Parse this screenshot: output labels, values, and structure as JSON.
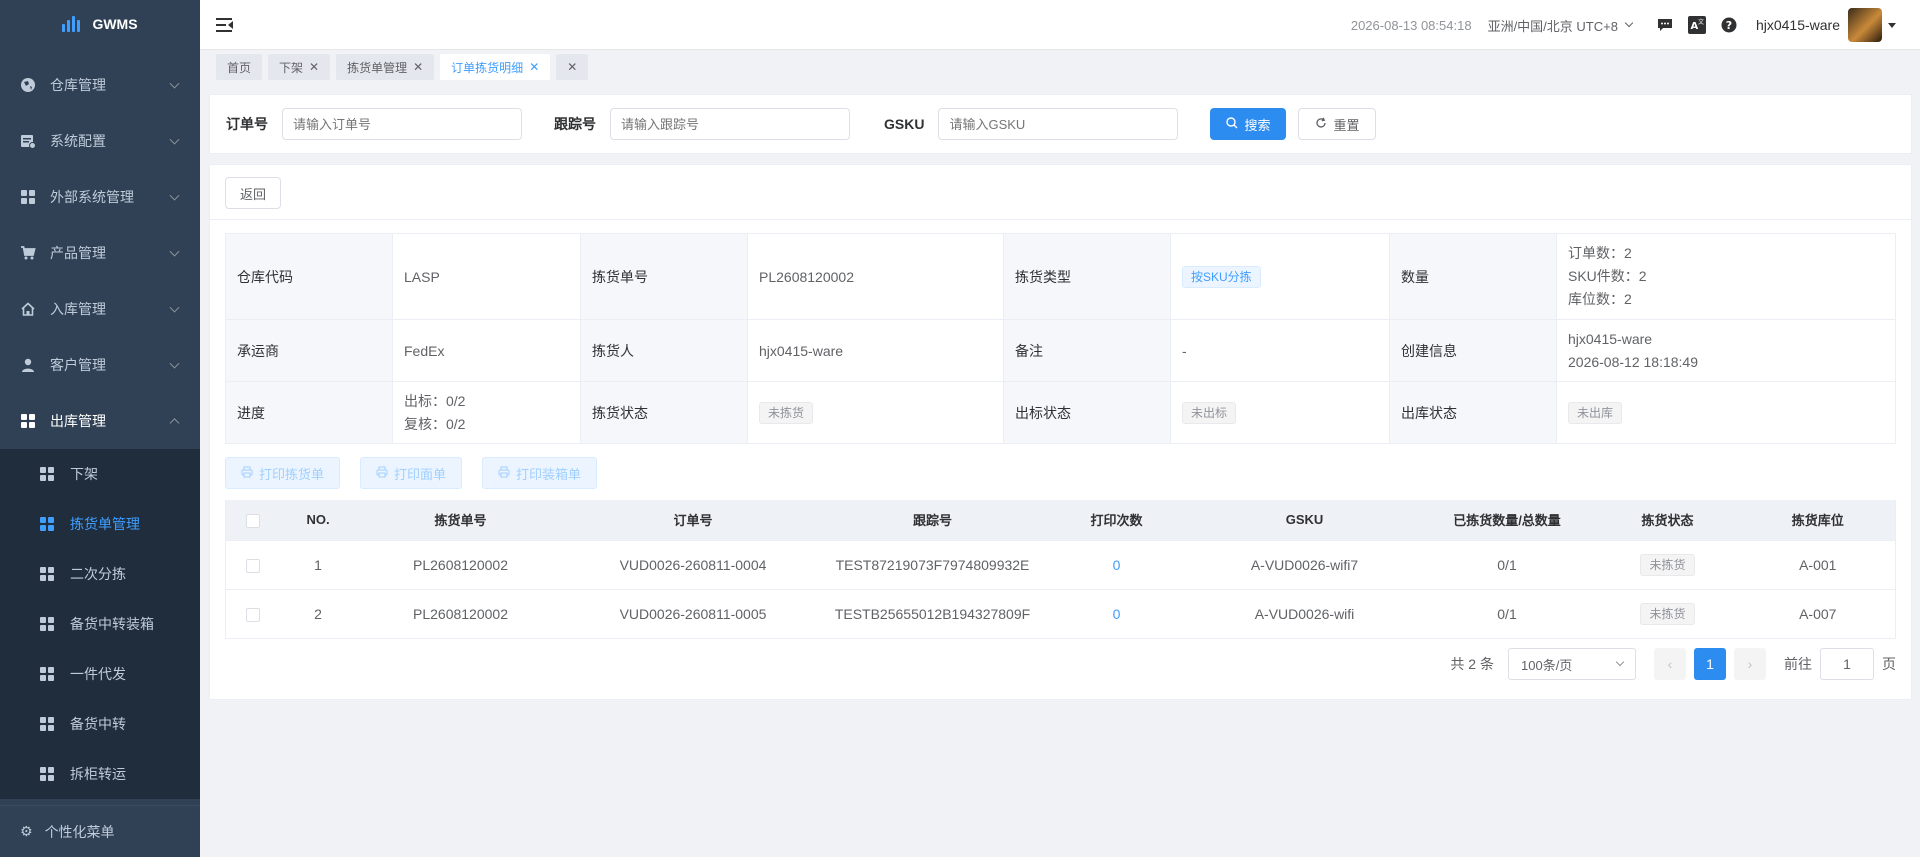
{
  "app": {
    "logo_text": "GWMS"
  },
  "sidebar": {
    "items": [
      {
        "label": "仓库管理",
        "icon": "globe-icon"
      },
      {
        "label": "系统配置",
        "icon": "config-icon"
      },
      {
        "label": "外部系统管理",
        "icon": "grid-icon"
      },
      {
        "label": "产品管理",
        "icon": "cart-icon"
      },
      {
        "label": "入库管理",
        "icon": "home-icon"
      },
      {
        "label": "客户管理",
        "icon": "user-icon"
      },
      {
        "label": "出库管理",
        "icon": "grid-icon"
      }
    ],
    "sub_items": [
      {
        "label": "下架"
      },
      {
        "label": "拣货单管理"
      },
      {
        "label": "二次分拣"
      },
      {
        "label": "备货中转装箱"
      },
      {
        "label": "一件代发"
      },
      {
        "label": "备货中转"
      },
      {
        "label": "拆柜转运"
      }
    ],
    "footer_label": "个性化菜单"
  },
  "header": {
    "datetime": "2026-08-13 08:54:18",
    "timezone": "亚洲/中国/北京 UTC+8",
    "username": "hjx0415-ware"
  },
  "tags": [
    {
      "label": "首页"
    },
    {
      "label": "下架"
    },
    {
      "label": "拣货单管理"
    },
    {
      "label": "订单拣货明细"
    }
  ],
  "search": {
    "order_label": "订单号",
    "order_placeholder": "请输入订单号",
    "tracking_label": "跟踪号",
    "tracking_placeholder": "请输入跟踪号",
    "gsku_label": "GSKU",
    "gsku_placeholder": "请输入GSKU",
    "search_btn": "搜索",
    "reset_btn": "重置"
  },
  "back_btn": "返回",
  "detail": {
    "warehouse_code_label": "仓库代码",
    "warehouse_code": "LASP",
    "pick_no_label": "拣货单号",
    "pick_no": "PL2608120002",
    "pick_type_label": "拣货类型",
    "pick_type": "按SKU分拣",
    "qty_label": "数量",
    "order_count": "订单数：2",
    "sku_count": "SKU件数：2",
    "location_count": "库位数：2",
    "carrier_label": "承运商",
    "carrier": "FedEx",
    "picker_label": "拣货人",
    "picker": "hjx0415-ware",
    "remark_label": "备注",
    "remark": "-",
    "created_label": "创建信息",
    "created_by": "hjx0415-ware",
    "created_at": "2026-08-12 18:18:49",
    "progress_label": "进度",
    "progress_label_out": "出标：0/2",
    "progress_review": "复核：0/2",
    "pick_status_label": "拣货状态",
    "pick_status": "未拣货",
    "label_status_label": "出标状态",
    "label_status": "未出标",
    "outbound_status_label": "出库状态",
    "outbound_status": "未出库"
  },
  "actions": {
    "print_pick": "打印拣货单",
    "print_sheet": "打印面单",
    "print_box": "打印装箱单"
  },
  "table": {
    "columns": [
      "NO.",
      "拣货单号",
      "订单号",
      "跟踪号",
      "打印次数",
      "GSKU",
      "已拣货数量/总数量",
      "拣货状态",
      "拣货库位"
    ],
    "rows": [
      {
        "no": "1",
        "pick_no": "PL2608120002",
        "order_no": "VUD0026-260811-0004",
        "tracking": "TEST87219073F7974809932E",
        "print_count": "0",
        "gsku": "A-VUD0026-wifi7",
        "qty": "0/1",
        "status": "未拣货",
        "location": "A-001"
      },
      {
        "no": "2",
        "pick_no": "PL2608120002",
        "order_no": "VUD0026-260811-0005",
        "tracking": "TESTB25655012B194327809F",
        "print_count": "0",
        "gsku": "A-VUD0026-wifi",
        "qty": "0/1",
        "status": "未拣货",
        "location": "A-007"
      }
    ]
  },
  "pagination": {
    "total": "共 2 条",
    "page_size": "100条/页",
    "current_page": "1",
    "goto_prefix": "前往",
    "goto_value": "1",
    "goto_suffix": "页"
  },
  "colors": {
    "primary": "#2d8cf0",
    "sidebar_bg": "#304156",
    "submenu_bg": "#1f2d3d",
    "active": "#409eff"
  }
}
